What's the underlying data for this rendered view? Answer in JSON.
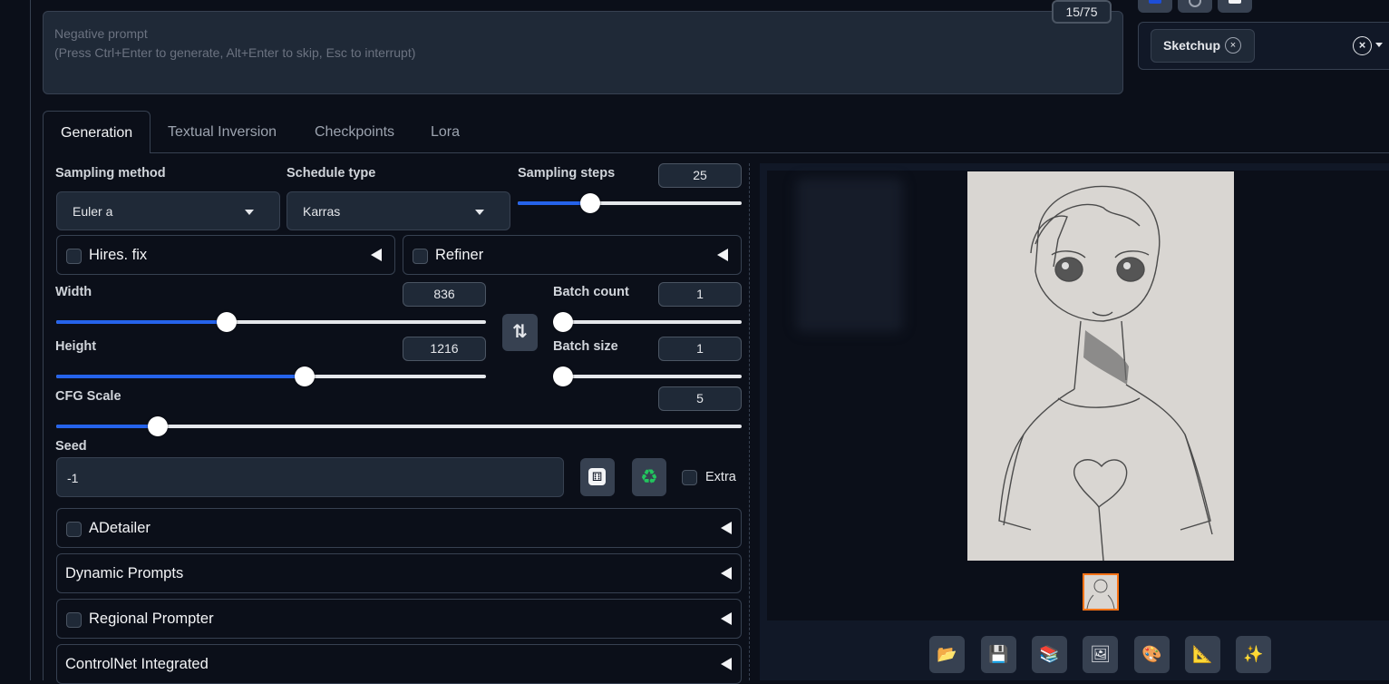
{
  "negative_prompt": {
    "placeholder": "Negative prompt\n(Press Ctrl+Enter to generate, Alt+Enter to skip, Esc to interrupt)",
    "token_count": "15/75"
  },
  "styles": {
    "selected_chip": "Sketchup",
    "chip_remove": "×",
    "clear": "×"
  },
  "tabs": [
    {
      "label": "Generation",
      "active": true
    },
    {
      "label": "Textual Inversion",
      "active": false
    },
    {
      "label": "Checkpoints",
      "active": false
    },
    {
      "label": "Lora",
      "active": false
    }
  ],
  "sampling": {
    "method_label": "Sampling method",
    "method_value": "Euler a",
    "schedule_label": "Schedule type",
    "schedule_value": "Karras",
    "steps_label": "Sampling steps",
    "steps_value": "25",
    "steps_fraction": 0.322
  },
  "hires": {
    "label": "Hires. fix"
  },
  "refiner": {
    "label": "Refiner"
  },
  "width": {
    "label": "Width",
    "value": "836",
    "fraction": 0.396
  },
  "height": {
    "label": "Height",
    "value": "1216",
    "fraction": 0.578
  },
  "batch_count": {
    "label": "Batch count",
    "value": "1",
    "fraction": 0.0
  },
  "batch_size": {
    "label": "Batch size",
    "value": "1",
    "fraction": 0.0
  },
  "cfg": {
    "label": "CFG Scale",
    "value": "5",
    "fraction": 0.148
  },
  "seed": {
    "label": "Seed",
    "value": "-1",
    "extra_label": "Extra"
  },
  "accordions": {
    "adetailer": "ADetailer",
    "dynamic_prompts": "Dynamic Prompts",
    "regional_prompter": "Regional Prompter",
    "controlnet": "ControlNet Integrated"
  },
  "icons": {
    "swap": "⇅",
    "dice": "🎲",
    "recycle": "♻",
    "folder": "📂",
    "save": "💾",
    "zip": "📚",
    "image": "🖼",
    "palette": "🎨",
    "ruler": "📐",
    "sparkles": "✨"
  },
  "colors": {
    "accent": "#2563eb",
    "background": "#0b0f19",
    "panel": "#1f2937",
    "border": "#374151",
    "selected_thumb": "#f97316"
  }
}
